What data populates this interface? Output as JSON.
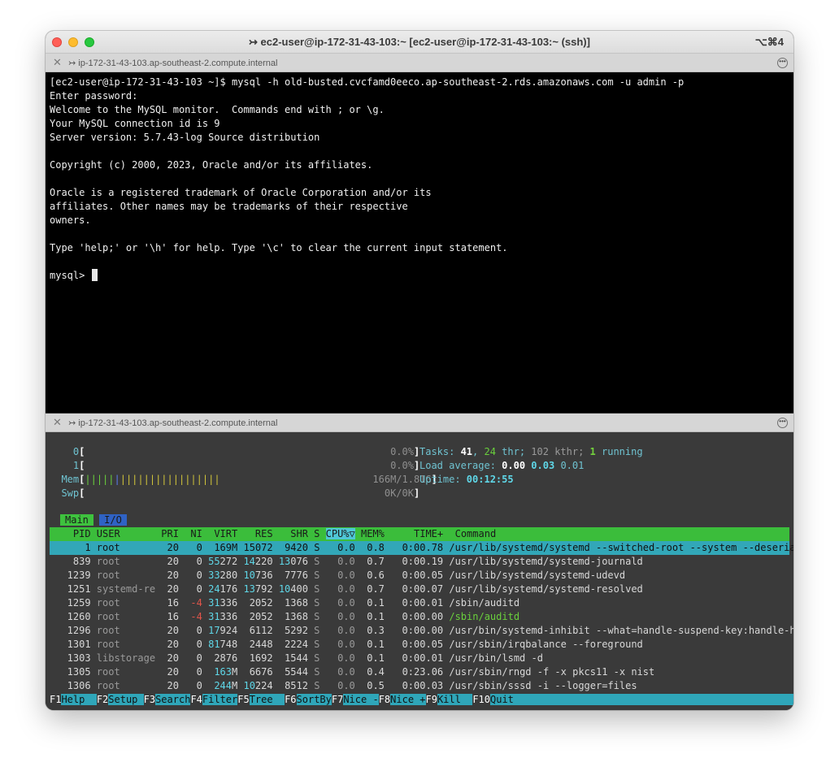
{
  "window": {
    "title": "↣ ec2-user@ip-172-31-43-103:~ [ec2-user@ip-172-31-43-103:~ (ssh)]",
    "shortcut": "⌥⌘4"
  },
  "pane1": {
    "title": "↣ ip-172-31-43-103.ap-southeast-2.compute.internal",
    "lines": [
      "[ec2-user@ip-172-31-43-103 ~]$ mysql -h old-busted.cvcfamd0eeco.ap-southeast-2.rds.amazonaws.com -u admin -p",
      "Enter password:",
      "Welcome to the MySQL monitor.  Commands end with ; or \\g.",
      "Your MySQL connection id is 9",
      "Server version: 5.7.43-log Source distribution",
      "",
      "Copyright (c) 2000, 2023, Oracle and/or its affiliates.",
      "",
      "Oracle is a registered trademark of Oracle Corporation and/or its",
      "affiliates. Other names may be trademarks of their respective",
      "owners.",
      "",
      "Type 'help;' or '\\h' for help. Type '\\c' to clear the current input statement.",
      ""
    ],
    "prompt": "mysql> "
  },
  "pane2": {
    "title": "↣ ip-172-31-43-103.ap-southeast-2.compute.internal",
    "meters": {
      "cpu0": {
        "label": "0",
        "value": "0.0%"
      },
      "cpu1": {
        "label": "1",
        "value": "0.0%"
      },
      "mem": {
        "label": "Mem",
        "value": "166M/1.81G"
      },
      "swp": {
        "label": "Swp",
        "value": "0K/0K"
      }
    },
    "summary": {
      "tasks_label": "Tasks: ",
      "tasks": "41",
      "thr": "24",
      "thr_label": " thr; ",
      "kthr": "102 kthr; ",
      "running": "1",
      "running_label": " running",
      "load_label": "Load average: ",
      "load1": "0.00",
      "load5": "0.03",
      "load15": "0.01",
      "uptime_label": "Uptime: ",
      "uptime": "00:12:55"
    },
    "tabs": {
      "main": "Main",
      "io": "I/O"
    },
    "columns": {
      "pid": "PID",
      "user": "USER",
      "pri": "PRI",
      "ni": "NI",
      "virt": "VIRT",
      "res": "RES",
      "shr": "SHR",
      "s": "S",
      "cpu": "CPU%▽",
      "mem": "MEM%",
      "time": "TIME+",
      "command": "Command"
    },
    "processes": [
      {
        "pid": "1",
        "user": "root",
        "pri": "20",
        "ni": "0",
        "virt": "169M",
        "res": "15072",
        "shr": "9420",
        "s": "S",
        "cpu": "0.0",
        "mem": "0.8",
        "time": "0:00.78",
        "command": "/usr/lib/systemd/systemd --switched-root --system --deserialize"
      },
      {
        "pid": "839",
        "user": "root",
        "pri": "20",
        "ni": "0",
        "virt": "55272",
        "res": "14220",
        "shr": "13076",
        "s": "S",
        "cpu": "0.0",
        "mem": "0.7",
        "time": "0:00.19",
        "command": "/usr/lib/systemd/systemd-journald"
      },
      {
        "pid": "1239",
        "user": "root",
        "pri": "20",
        "ni": "0",
        "virt": "33280",
        "res": "10736",
        "shr": "7776",
        "s": "S",
        "cpu": "0.0",
        "mem": "0.6",
        "time": "0:00.05",
        "command": "/usr/lib/systemd/systemd-udevd"
      },
      {
        "pid": "1251",
        "user": "systemd-re",
        "pri": "20",
        "ni": "0",
        "virt": "24176",
        "res": "13792",
        "shr": "10400",
        "s": "S",
        "cpu": "0.0",
        "mem": "0.7",
        "time": "0:00.07",
        "command": "/usr/lib/systemd/systemd-resolved"
      },
      {
        "pid": "1259",
        "user": "root",
        "pri": "16",
        "ni": "-4",
        "virt": "31336",
        "res": "2052",
        "shr": "1368",
        "s": "S",
        "cpu": "0.0",
        "mem": "0.1",
        "time": "0:00.01",
        "command": "/sbin/auditd"
      },
      {
        "pid": "1260",
        "user": "root",
        "pri": "16",
        "ni": "-4",
        "virt": "31336",
        "res": "2052",
        "shr": "1368",
        "s": "S",
        "cpu": "0.0",
        "mem": "0.1",
        "time": "0:00.00",
        "command": "/sbin/auditd"
      },
      {
        "pid": "1296",
        "user": "root",
        "pri": "20",
        "ni": "0",
        "virt": "17924",
        "res": "6112",
        "shr": "5292",
        "s": "S",
        "cpu": "0.0",
        "mem": "0.3",
        "time": "0:00.00",
        "command": "/usr/bin/systemd-inhibit --what=handle-suspend-key:handle-hiber"
      },
      {
        "pid": "1301",
        "user": "root",
        "pri": "20",
        "ni": "0",
        "virt": "81748",
        "res": "2448",
        "shr": "2224",
        "s": "S",
        "cpu": "0.0",
        "mem": "0.1",
        "time": "0:00.05",
        "command": "/usr/sbin/irqbalance --foreground"
      },
      {
        "pid": "1303",
        "user": "libstorage",
        "pri": "20",
        "ni": "0",
        "virt": "2876",
        "res": "1692",
        "shr": "1544",
        "s": "S",
        "cpu": "0.0",
        "mem": "0.1",
        "time": "0:00.01",
        "command": "/usr/bin/lsmd -d"
      },
      {
        "pid": "1305",
        "user": "root",
        "pri": "20",
        "ni": "0",
        "virt": "163M",
        "res": "6676",
        "shr": "5544",
        "s": "S",
        "cpu": "0.0",
        "mem": "0.4",
        "time": "0:23.06",
        "command": "/usr/sbin/rngd -f -x pkcs11 -x nist"
      },
      {
        "pid": "1306",
        "user": "root",
        "pri": "20",
        "ni": "0",
        "virt": "244M",
        "res": "10224",
        "shr": "8512",
        "s": "S",
        "cpu": "0.0",
        "mem": "0.5",
        "time": "0:00.03",
        "command": "/usr/sbin/sssd -i --logger=files"
      }
    ],
    "fkeys": [
      {
        "key": "F1",
        "label": "Help  "
      },
      {
        "key": "F2",
        "label": "Setup "
      },
      {
        "key": "F3",
        "label": "Search"
      },
      {
        "key": "F4",
        "label": "Filter"
      },
      {
        "key": "F5",
        "label": "Tree  "
      },
      {
        "key": "F6",
        "label": "SortBy"
      },
      {
        "key": "F7",
        "label": "Nice -"
      },
      {
        "key": "F8",
        "label": "Nice +"
      },
      {
        "key": "F9",
        "label": "Kill  "
      },
      {
        "key": "F10",
        "label": "Quit"
      }
    ]
  },
  "colors": {
    "terminal_bg": "#000000",
    "htop_bg": "#3a3a3a",
    "header_green": "#3bbd3b",
    "selected_row": "#32a7b8",
    "io_tab": "#2f62c4"
  }
}
